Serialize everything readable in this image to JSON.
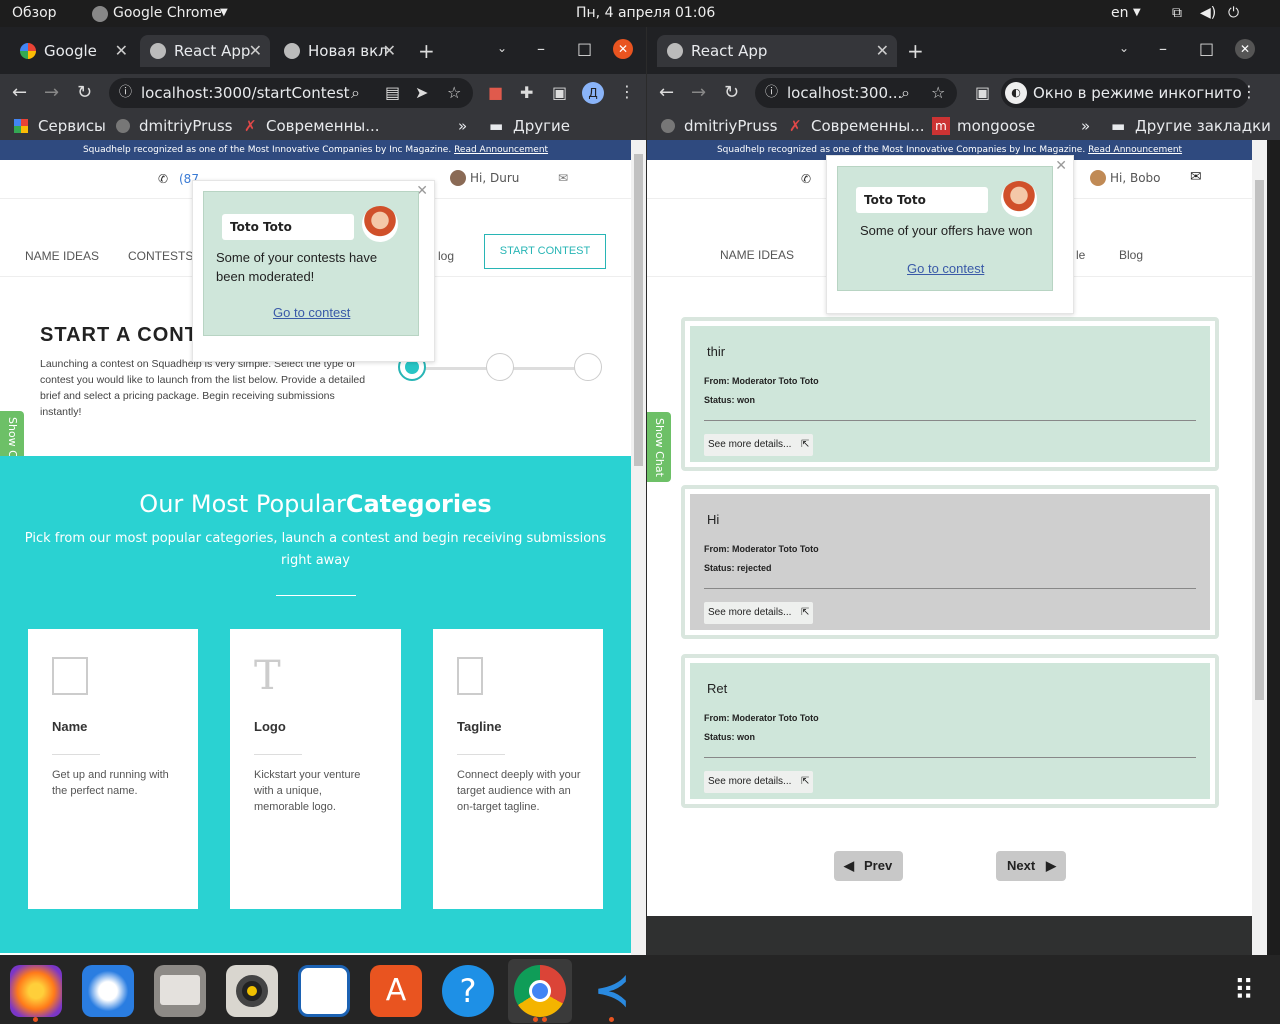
{
  "system": {
    "overview": "Обзор",
    "app_name": "Google Chrome",
    "datetime": "Пн, 4 апреля  01:06",
    "lang": "en"
  },
  "left_window": {
    "tabs": [
      {
        "label": "Google",
        "active": false
      },
      {
        "label": "React App",
        "active": true
      },
      {
        "label": "Новая вкл",
        "active": false
      }
    ],
    "url": "localhost:3000/startContest",
    "profile_letter": "Д",
    "bookmarks": [
      "Сервисы",
      "dmitriyPruss",
      "Современны...",
      "Другие закладки"
    ],
    "page": {
      "banner": "Squadhelp recognized as one of the Most Innovative Companies by Inc Magazine.",
      "banner_link": "Read Announcement",
      "phone": "(87",
      "user": "Hi, Duru",
      "nav": [
        "NAME IDEAS",
        "CONTESTS",
        "log"
      ],
      "start_contest": "START CONTEST",
      "heading": "START A CONT",
      "intro": "Launching a contest on Squadhelp is very simple. Select the type of contest you would like to launch from the list below. Provide a detailed brief and select a pricing package. Begin receiving submissions instantly!",
      "show_chat": "Show Chat",
      "categories_title_light": "Our Most Popular",
      "categories_title_bold": "Categories",
      "categories_sub": "Pick from our most popular categories, launch a contest and begin receiving submissions right away",
      "cards": [
        {
          "title": "Name",
          "text": "Get up and running with the perfect name."
        },
        {
          "title": "Logo",
          "text": "Kickstart your venture with a unique, memorable logo."
        },
        {
          "title": "Tagline",
          "text": "Connect deeply with your target audience with an on-target tagline."
        }
      ],
      "notification": {
        "from": "Toto Toto",
        "message": "Some of your contests have been moderated!",
        "link": "Go to contest"
      }
    }
  },
  "right_window": {
    "tabs": [
      {
        "label": "React App",
        "active": true
      }
    ],
    "url": "localhost:300...",
    "incognito": "Окно в режиме инкогнито",
    "bookmarks": [
      "dmitriyPruss",
      "Современны...",
      "mongoose",
      "Другие закладки"
    ],
    "page": {
      "banner": "Squadhelp recognized as one of the Most Innovative Companies by Inc Magazine.",
      "banner_link": "Read Announcement",
      "user": "Hi, Bobo",
      "nav": [
        "NAME IDEAS",
        "le",
        "Blog"
      ],
      "show_chat": "Show Chat",
      "notification": {
        "from": "Toto Toto",
        "message": "Some of your offers have won",
        "link": "Go to contest"
      },
      "offers": [
        {
          "title": "thir",
          "from": "From: Moderator Toto Toto",
          "status": "Status: won",
          "button": "See more details...",
          "bg": "#cfe6da"
        },
        {
          "title": "Hi",
          "from": "From: Moderator Toto Toto",
          "status": "Status: rejected",
          "button": "See more details...",
          "bg": "#cfcfcf"
        },
        {
          "title": "Ret",
          "from": "From: Moderator Toto Toto",
          "status": "Status: won",
          "button": "See more details...",
          "bg": "#cfe6da"
        }
      ],
      "prev": "Prev",
      "next": "Next"
    }
  },
  "dock": [
    "firefox",
    "thunderbird",
    "files",
    "rhythmbox",
    "writer",
    "software-center",
    "help",
    "chrome",
    "vscode",
    "apps-grid"
  ]
}
